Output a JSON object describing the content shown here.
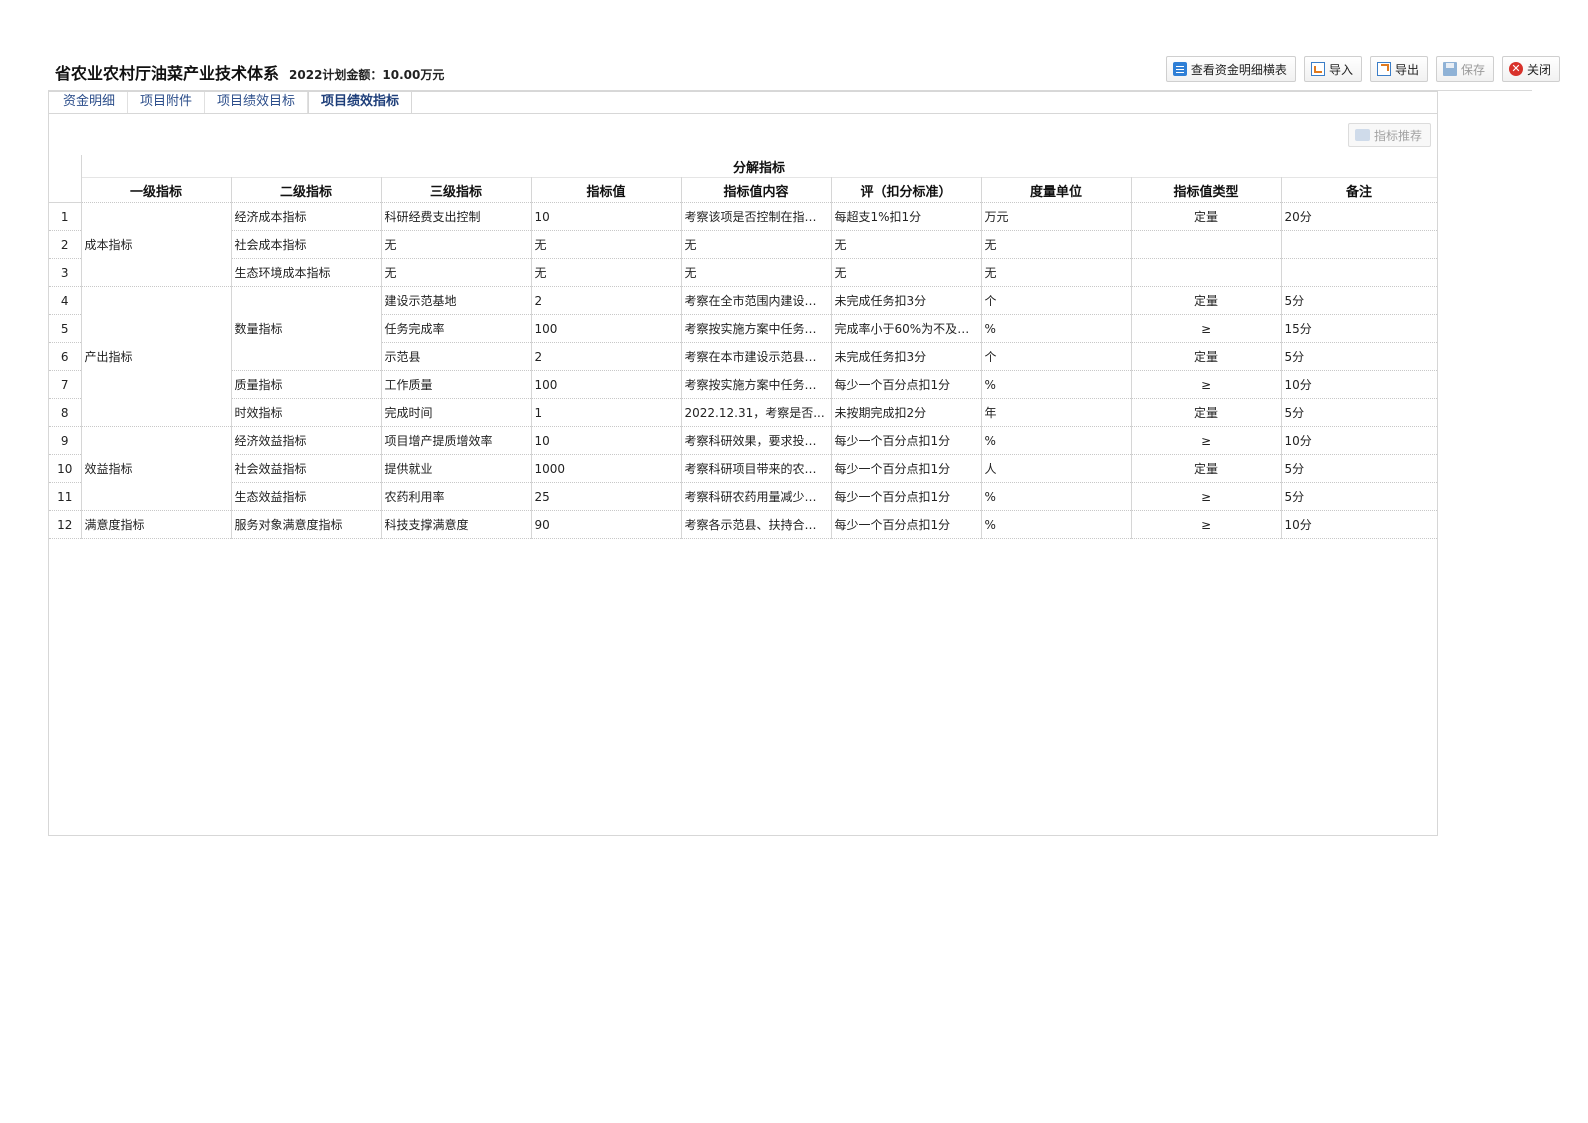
{
  "header": {
    "title": "省农业农村厅油菜产业技术体系",
    "plan_amount": "2022计划金额：10.00万元"
  },
  "toolbar": {
    "view_detail": "查看资金明细横表",
    "import": "导入",
    "export": "导出",
    "save": "保存",
    "close": "关闭"
  },
  "tabs": [
    "资金明细",
    "项目附件",
    "项目绩效目标",
    "项目绩效指标"
  ],
  "active_tab": "项目绩效指标",
  "recommend_button": "指标推荐",
  "table": {
    "group_header": "分解指标",
    "columns": [
      "一级指标",
      "二级指标",
      "三级指标",
      "指标值",
      "指标值内容",
      "评（扣分标准）",
      "度量单位",
      "指标值类型",
      "备注"
    ],
    "rows": [
      {
        "no": "1",
        "l1": "成本指标",
        "l2": "经济成本指标",
        "l3": "科研经费支出控制",
        "value": "10",
        "content": "考察该项是否控制在指标...",
        "score": "每超支1%扣1分",
        "unit": "万元",
        "type": "定量",
        "note": "20分"
      },
      {
        "no": "2",
        "l1": "",
        "l2": "社会成本指标",
        "l3": "无",
        "value": "无",
        "content": "无",
        "score": "无",
        "unit": "无",
        "type": "",
        "note": ""
      },
      {
        "no": "3",
        "l1": "",
        "l2": "生态环境成本指标",
        "l3": "无",
        "value": "无",
        "content": "无",
        "score": "无",
        "unit": "无",
        "type": "",
        "note": ""
      },
      {
        "no": "4",
        "l1": "产出指标",
        "l2": "数量指标",
        "l3": "建设示范基地",
        "value": "2",
        "content": "考察在全市范围内建设示...",
        "score": "未完成任务扣3分",
        "unit": "个",
        "type": "定量",
        "note": "5分"
      },
      {
        "no": "5",
        "l1": "",
        "l2": "",
        "l3": "任务完成率",
        "value": "100",
        "content": "考察按实施方案中任务要...",
        "score": "完成率小于60%为不及格...",
        "unit": "%",
        "type": "≥",
        "note": "15分"
      },
      {
        "no": "6",
        "l1": "",
        "l2": "",
        "l3": "示范县",
        "value": "2",
        "content": "考察在本市建设示范县的...",
        "score": "未完成任务扣3分",
        "unit": "个",
        "type": "定量",
        "note": "5分"
      },
      {
        "no": "7",
        "l1": "",
        "l2": "质量指标",
        "l3": "工作质量",
        "value": "100",
        "content": "考察按实施方案中任务要...",
        "score": "每少一个百分点扣1分",
        "unit": "%",
        "type": "≥",
        "note": "10分"
      },
      {
        "no": "8",
        "l1": "",
        "l2": "时效指标",
        "l3": "完成时间",
        "value": "1",
        "content": "2022.12.31，考察是否...",
        "score": "未按期完成扣2分",
        "unit": "年",
        "type": "定量",
        "note": "5分"
      },
      {
        "no": "9",
        "l1": "效益指标",
        "l2": "经济效益指标",
        "l3": "项目增产提质增效率",
        "value": "10",
        "content": "考察科研效果，要求投入...",
        "score": "每少一个百分点扣1分",
        "unit": "%",
        "type": "≥",
        "note": "10分"
      },
      {
        "no": "10",
        "l1": "",
        "l2": "社会效益指标",
        "l3": "提供就业",
        "value": "1000",
        "content": "考察科研项目带来的农民...",
        "score": "每少一个百分点扣1分",
        "unit": "人",
        "type": "定量",
        "note": "5分"
      },
      {
        "no": "11",
        "l1": "",
        "l2": "生态效益指标",
        "l3": "农药利用率",
        "value": "25",
        "content": "考察科研农药用量减少程...",
        "score": "每少一个百分点扣1分",
        "unit": "%",
        "type": "≥",
        "note": "5分"
      },
      {
        "no": "12",
        "l1": "满意度指标",
        "l2": "服务对象满意度指标",
        "l3": "科技支撑满意度",
        "value": "90",
        "content": "考察各示范县、扶持合作...",
        "score": "每少一个百分点扣1分",
        "unit": "%",
        "type": "≥",
        "note": "10分"
      }
    ]
  }
}
